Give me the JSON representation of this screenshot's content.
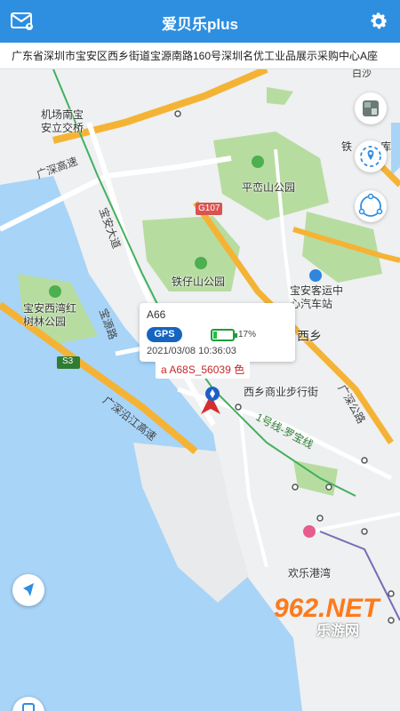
{
  "app": {
    "title": "爱贝乐plus"
  },
  "header": {
    "mail_icon": "mail-user-icon",
    "settings_icon": "gear-icon"
  },
  "address_bar": {
    "text": "广东省深圳市宝安区西乡街道宝源南路160号深圳名优工业品展示采购中心A座"
  },
  "map": {
    "labels": {
      "airport_interchange": "机场南宝\n安立交桥",
      "road_shenzhen_expressway": "广深高速",
      "pingluan_park": "平峦山公园",
      "g107": "G107",
      "bao_an_avenue": "宝安大道",
      "tiezai_park": "铁仔山公园",
      "bao_an_bay_park": "宝安西湾红\n树林公园",
      "bao_an_bus_station": "宝安客运中\n心汽车站",
      "baoyuan_road": "宝源路",
      "s3": "S3",
      "xixiang": "西乡",
      "guangshen_coastal": "广深沿江高速",
      "xixiang_street": "西乡商业步行街",
      "guangshen_road": "广深公路",
      "metro_line1": "1号线-罗宝线",
      "happy_harbor": "欢乐港湾",
      "baisha": "白沙",
      "tie": "铁",
      "ku": "库"
    }
  },
  "popup": {
    "device_name": "A66",
    "gps_badge": "GPS",
    "battery_percent": "17%",
    "battery_level": 0.17,
    "timestamp": "2021/03/08 10:36:03"
  },
  "plate": {
    "text": "a  A68S_56039  色"
  },
  "side_buttons": [
    "satellite-map-icon",
    "track-icon",
    "fence-icon"
  ],
  "bottom_buttons": [
    "locate-icon",
    "phone-icon"
  ],
  "watermark": {
    "brand": "962.NET",
    "sub": "乐游网"
  },
  "colors": {
    "header": "#2e8fe0",
    "water": "#a8d4f7",
    "park": "#b7dca0",
    "highway": "#f5b335",
    "metro_green": "#43b05c",
    "plate_red": "#c62828",
    "gps_blue": "#1565c0",
    "battery_green": "#1fbf40"
  }
}
